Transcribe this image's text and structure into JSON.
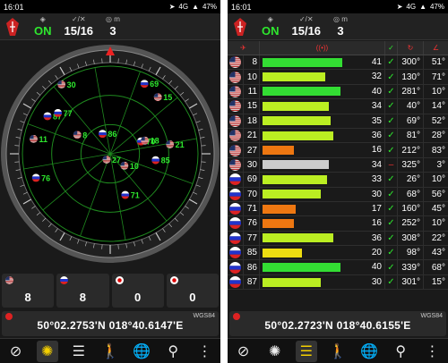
{
  "left": {
    "status": {
      "time": "16:01",
      "battery": "47%",
      "network": "4G"
    },
    "top": {
      "fix": "ON",
      "sats": "15/16",
      "count": "3"
    },
    "radar": {
      "satellites": [
        {
          "prn": "30",
          "flag": "us",
          "az": 325,
          "el": 3
        },
        {
          "prn": "87",
          "flag": "ru",
          "az": 301,
          "el": 15
        },
        {
          "prn": "77",
          "flag": "ru",
          "az": 308,
          "el": 22
        },
        {
          "prn": "69",
          "flag": "ru",
          "az": 26,
          "el": 10
        },
        {
          "prn": "15",
          "flag": "us",
          "az": 40,
          "el": 14
        },
        {
          "prn": "11",
          "flag": "us",
          "az": 281,
          "el": 10
        },
        {
          "prn": "8",
          "flag": "us",
          "az": 300,
          "el": 51
        },
        {
          "prn": "86",
          "flag": "ru",
          "az": 339,
          "el": 68
        },
        {
          "prn": "76",
          "flag": "ru",
          "az": 252,
          "el": 10
        },
        {
          "prn": "70",
          "flag": "ru",
          "az": 68,
          "el": 56
        },
        {
          "prn": "18",
          "flag": "us",
          "az": 69,
          "el": 52
        },
        {
          "prn": "27",
          "flag": "us",
          "az": 212,
          "el": 83
        },
        {
          "prn": "10",
          "flag": "us",
          "az": 130,
          "el": 71
        },
        {
          "prn": "21",
          "flag": "us",
          "az": 81,
          "el": 28
        },
        {
          "prn": "85",
          "flag": "ru",
          "az": 98,
          "el": 43
        },
        {
          "prn": "71",
          "flag": "ru",
          "az": 160,
          "el": 45
        }
      ]
    },
    "counts": [
      {
        "flag": "us",
        "value": "8"
      },
      {
        "flag": "ru",
        "value": "8"
      },
      {
        "flag": "jp",
        "value": "0"
      },
      {
        "flag": "jp",
        "value": "0"
      }
    ],
    "coords": {
      "label": "WGS84",
      "text": "50°02.2753'N  018°40.6147'E"
    }
  },
  "right": {
    "status": {
      "time": "16:01",
      "battery": "47%",
      "network": "4G"
    },
    "top": {
      "fix": "ON",
      "sats": "15/16",
      "count": "3"
    },
    "table": {
      "headers": [
        "prn-icon",
        "signal-icon",
        "used-icon",
        "azimuth-icon",
        "elevation-icon"
      ],
      "rows": [
        {
          "flag": "us",
          "prn": "8",
          "snr": 41,
          "color": "#33dd33",
          "used": true,
          "az": "300°",
          "el": "51°"
        },
        {
          "flag": "us",
          "prn": "10",
          "snr": 32,
          "color": "#bbee22",
          "used": true,
          "az": "130°",
          "el": "71°"
        },
        {
          "flag": "us",
          "prn": "11",
          "snr": 40,
          "color": "#33dd33",
          "used": true,
          "az": "281°",
          "el": "10°"
        },
        {
          "flag": "us",
          "prn": "15",
          "snr": 34,
          "color": "#bbee22",
          "used": true,
          "az": "40°",
          "el": "14°"
        },
        {
          "flag": "us",
          "prn": "18",
          "snr": 35,
          "color": "#bbee22",
          "used": true,
          "az": "69°",
          "el": "52°"
        },
        {
          "flag": "us",
          "prn": "21",
          "snr": 36,
          "color": "#bbee22",
          "used": true,
          "az": "81°",
          "el": "28°"
        },
        {
          "flag": "us",
          "prn": "27",
          "snr": 16,
          "color": "#ee7711",
          "used": true,
          "az": "212°",
          "el": "83°"
        },
        {
          "flag": "us",
          "prn": "30",
          "snr": 34,
          "color": "#cccccc",
          "used": false,
          "az": "325°",
          "el": "3°"
        },
        {
          "flag": "ru",
          "prn": "69",
          "snr": 33,
          "color": "#bbee22",
          "used": true,
          "az": "26°",
          "el": "10°"
        },
        {
          "flag": "ru",
          "prn": "70",
          "snr": 30,
          "color": "#bbee22",
          "used": true,
          "az": "68°",
          "el": "56°"
        },
        {
          "flag": "ru",
          "prn": "71",
          "snr": 17,
          "color": "#ee7711",
          "used": true,
          "az": "160°",
          "el": "45°"
        },
        {
          "flag": "ru",
          "prn": "76",
          "snr": 16,
          "color": "#ee7711",
          "used": true,
          "az": "252°",
          "el": "10°"
        },
        {
          "flag": "ru",
          "prn": "77",
          "snr": 36,
          "color": "#bbee22",
          "used": true,
          "az": "308°",
          "el": "22°"
        },
        {
          "flag": "ru",
          "prn": "85",
          "snr": 20,
          "color": "#eedd11",
          "used": true,
          "az": "98°",
          "el": "43°"
        },
        {
          "flag": "ru",
          "prn": "86",
          "snr": 40,
          "color": "#33dd33",
          "used": true,
          "az": "339°",
          "el": "68°"
        },
        {
          "flag": "ru",
          "prn": "87",
          "snr": 30,
          "color": "#bbee22",
          "used": true,
          "az": "301°",
          "el": "15°"
        }
      ]
    },
    "coords": {
      "label": "WGS84",
      "text": "50°02.2723'N  018°40.6155'E"
    }
  },
  "nav": [
    "compass-icon",
    "radar-icon",
    "signal-bars-icon",
    "walk-icon",
    "globe-icon",
    "location-pin-icon",
    "more-icon"
  ],
  "colors": {
    "accent": "#2ee82e",
    "used_mark": "#2ee82e",
    "header_icon": "#e33333"
  }
}
